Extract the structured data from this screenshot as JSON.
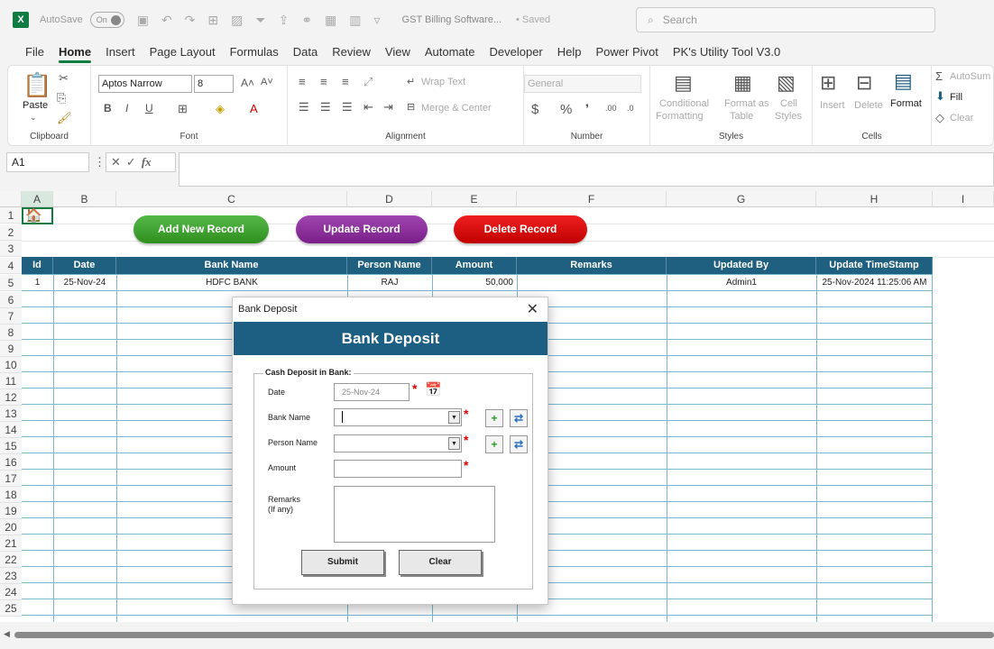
{
  "titlebar": {
    "autosave_label": "AutoSave",
    "toggle_state": "On",
    "doc_title": "GST Billing Software...",
    "saved_status": "• Saved",
    "search_placeholder": "Search"
  },
  "menu": [
    "File",
    "Home",
    "Insert",
    "Page Layout",
    "Formulas",
    "Data",
    "Review",
    "View",
    "Automate",
    "Developer",
    "Help",
    "Power Pivot",
    "PK's Utility Tool V3.0"
  ],
  "ribbon": {
    "clipboard": {
      "paste": "Paste",
      "label": "Clipboard"
    },
    "font": {
      "family": "Aptos Narrow",
      "size": "8",
      "label": "Font"
    },
    "alignment": {
      "wrap": "Wrap Text",
      "merge": "Merge & Center",
      "label": "Alignment"
    },
    "number": {
      "format": "General",
      "label": "Number"
    },
    "styles": {
      "conditional_1": "Conditional",
      "conditional_2": "Formatting",
      "format_table_1": "Format as",
      "format_table_2": "Table",
      "cell_styles_1": "Cell",
      "cell_styles_2": "Styles",
      "label": "Styles"
    },
    "cells": {
      "insert": "Insert",
      "delete": "Delete",
      "format": "Format",
      "label": "Cells"
    },
    "editing": {
      "autosum": "AutoSum",
      "fill": "Fill",
      "clear": "Clear"
    }
  },
  "formula_bar": {
    "name_box": "A1",
    "fx": "fx"
  },
  "columns": [
    "A",
    "B",
    "C",
    "D",
    "E",
    "F",
    "G",
    "H",
    "I"
  ],
  "rows": [
    "1",
    "2",
    "3",
    "4",
    "5",
    "6",
    "7",
    "8",
    "9",
    "10",
    "11",
    "12",
    "13",
    "14",
    "15",
    "16",
    "17",
    "18",
    "19",
    "20",
    "21",
    "22",
    "23",
    "24",
    "25"
  ],
  "sheet_buttons": {
    "add": "Add New Record",
    "update": "Update Record",
    "delete": "Delete Record"
  },
  "table": {
    "headers": [
      "Id",
      "Date",
      "Bank Name",
      "Person Name",
      "Amount",
      "Remarks",
      "Updated By",
      "Update TimeStamp"
    ],
    "row1": [
      "1",
      "25-Nov-24",
      "HDFC BANK",
      "RAJ",
      "50,000",
      "",
      "Admin1",
      "25-Nov-2024 11:25:06 AM"
    ]
  },
  "dialog": {
    "window_title": "Bank Deposit",
    "close": "✕",
    "banner": "Bank Deposit",
    "group_title": "Cash Deposit in Bank:",
    "date_label": "Date",
    "date_value": "25-Nov-24",
    "bank_label": "Bank Name",
    "person_label": "Person Name",
    "amount_label": "Amount",
    "remarks_label_1": "Remarks",
    "remarks_label_2": "(If any)",
    "required_mark": "*",
    "add_symbol": "+",
    "submit": "Submit",
    "clear": "Clear"
  },
  "colors": {
    "excel_green": "#107c41",
    "table_header": "#1f5f80",
    "dialog_banner": "#1d5f82"
  }
}
